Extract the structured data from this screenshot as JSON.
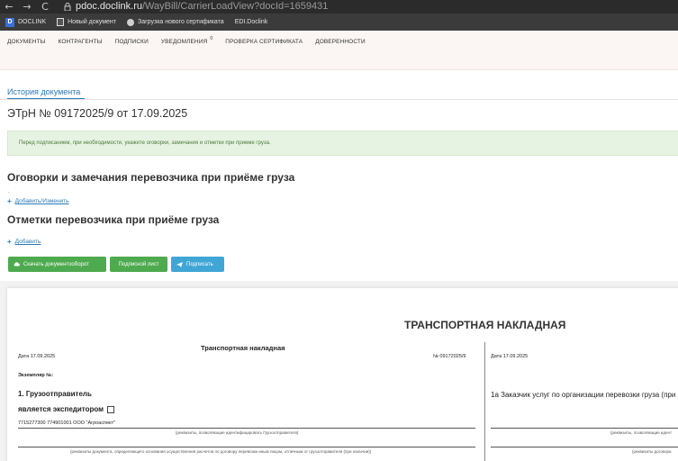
{
  "browser": {
    "back": "←",
    "forward": "→",
    "reload": "C",
    "url_host": "pdoc.doclink.ru",
    "url_path": "/WayBill/CarrierLoadView?docId=1659431"
  },
  "bookmarks": [
    {
      "label": "DOCLINK",
      "logo": "D"
    },
    {
      "label": "Новый документ"
    },
    {
      "label": "Загрузка нового сертификата"
    },
    {
      "label": "EDI.Doclink"
    }
  ],
  "nav": {
    "items": [
      "ДОКУМЕНТЫ",
      "КОНТРАГЕНТЫ",
      "ПОДПИСКИ",
      "УВЕДОМЛЕНИЯ",
      "ПРОВЕРКА СЕРТИФИКАТА",
      "ДОВЕРЕННОСТИ"
    ],
    "notifications_badge": "0"
  },
  "history_link": "История документа",
  "doc_title": "ЭТрН №   09172025/9   от   17.09.2025",
  "alert_text": "Перед подписанием, при необходимости, укажите оговорки, замечания и отметки при приеме груза.",
  "section_remarks": {
    "title": "Оговорки и замечания перевозчика при приёме груза",
    "dot": ".",
    "add_label": "Добавить/Изменить"
  },
  "section_marks": {
    "title": "Отметки перевозчика при приёме груза",
    "add_label": "Добавить"
  },
  "buttons": {
    "download": "Скачать документооборот",
    "sign_sheet": "Подписной лист",
    "sign": "Подписать"
  },
  "colors": {
    "green_button": "#4eaa4e",
    "blue_button": "#3fa6d6",
    "link": "#2a7ab8",
    "alert_bg": "#e7f3e2"
  },
  "preview": {
    "main_title": "ТРАНСПОРТНАЯ НАКЛАДНАЯ",
    "sub_title": "Транспортная накладная",
    "date_left": "Дата  17.09.2025",
    "number": "№   09172025/9",
    "date_right": "Дата  17.09.2025",
    "copy_label": "Экземпляр №:",
    "shipper_heading": "1. Грузоотправитель",
    "forwarder_label": "является экспедитором",
    "shipper_value": "7715277300 774901001 ООО \"Агроаспект\"",
    "shipper_caption": "(реквизиты, позволяющие идентифицировать Грузоотправителя)",
    "document_caption": "(реквизиты документа, определяющего основания осуществления расчетов по договору перевозки иным лицом, отличным от грузоотправителя (при наличии))",
    "customer_heading": "1а Заказчик услуг по организации перевозки груза (при",
    "right_caption_1": "(реквизиты, позволяющие идент",
    "right_caption_2": "(реквизиты договора"
  }
}
